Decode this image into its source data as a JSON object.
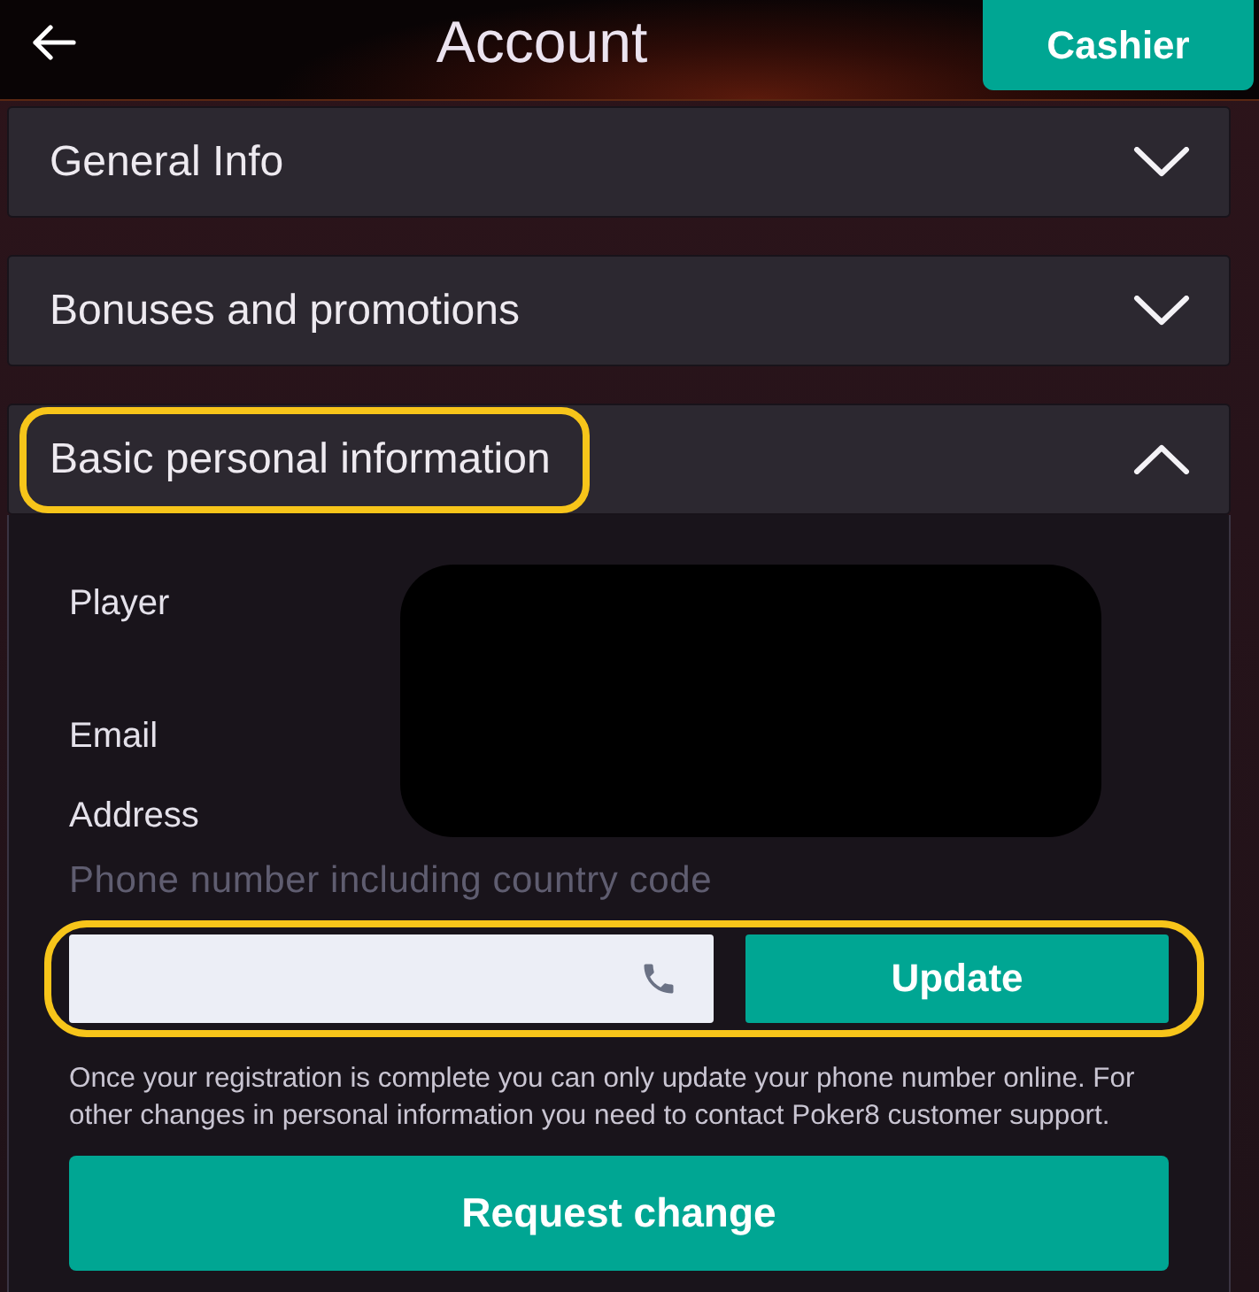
{
  "header": {
    "title": "Account",
    "cashier_button": "Cashier"
  },
  "sections": [
    {
      "title": "General Info",
      "expanded": false,
      "highlighted": false
    },
    {
      "title": "Bonuses and promotions",
      "expanded": false,
      "highlighted": false
    },
    {
      "title": "Basic personal information",
      "expanded": true,
      "highlighted": true,
      "content": {
        "fields": [
          {
            "label": "Player"
          },
          {
            "label": "Email"
          },
          {
            "label": "Address"
          }
        ],
        "values_redacted": true,
        "phone": {
          "label": "Phone number including country code",
          "highlighted": true,
          "update_button": "Update"
        },
        "notice": "Once your registration is complete you can only update your phone number online. For other changes in personal information you need to contact Poker8 customer support.",
        "request_button": "Request change"
      }
    }
  ]
}
